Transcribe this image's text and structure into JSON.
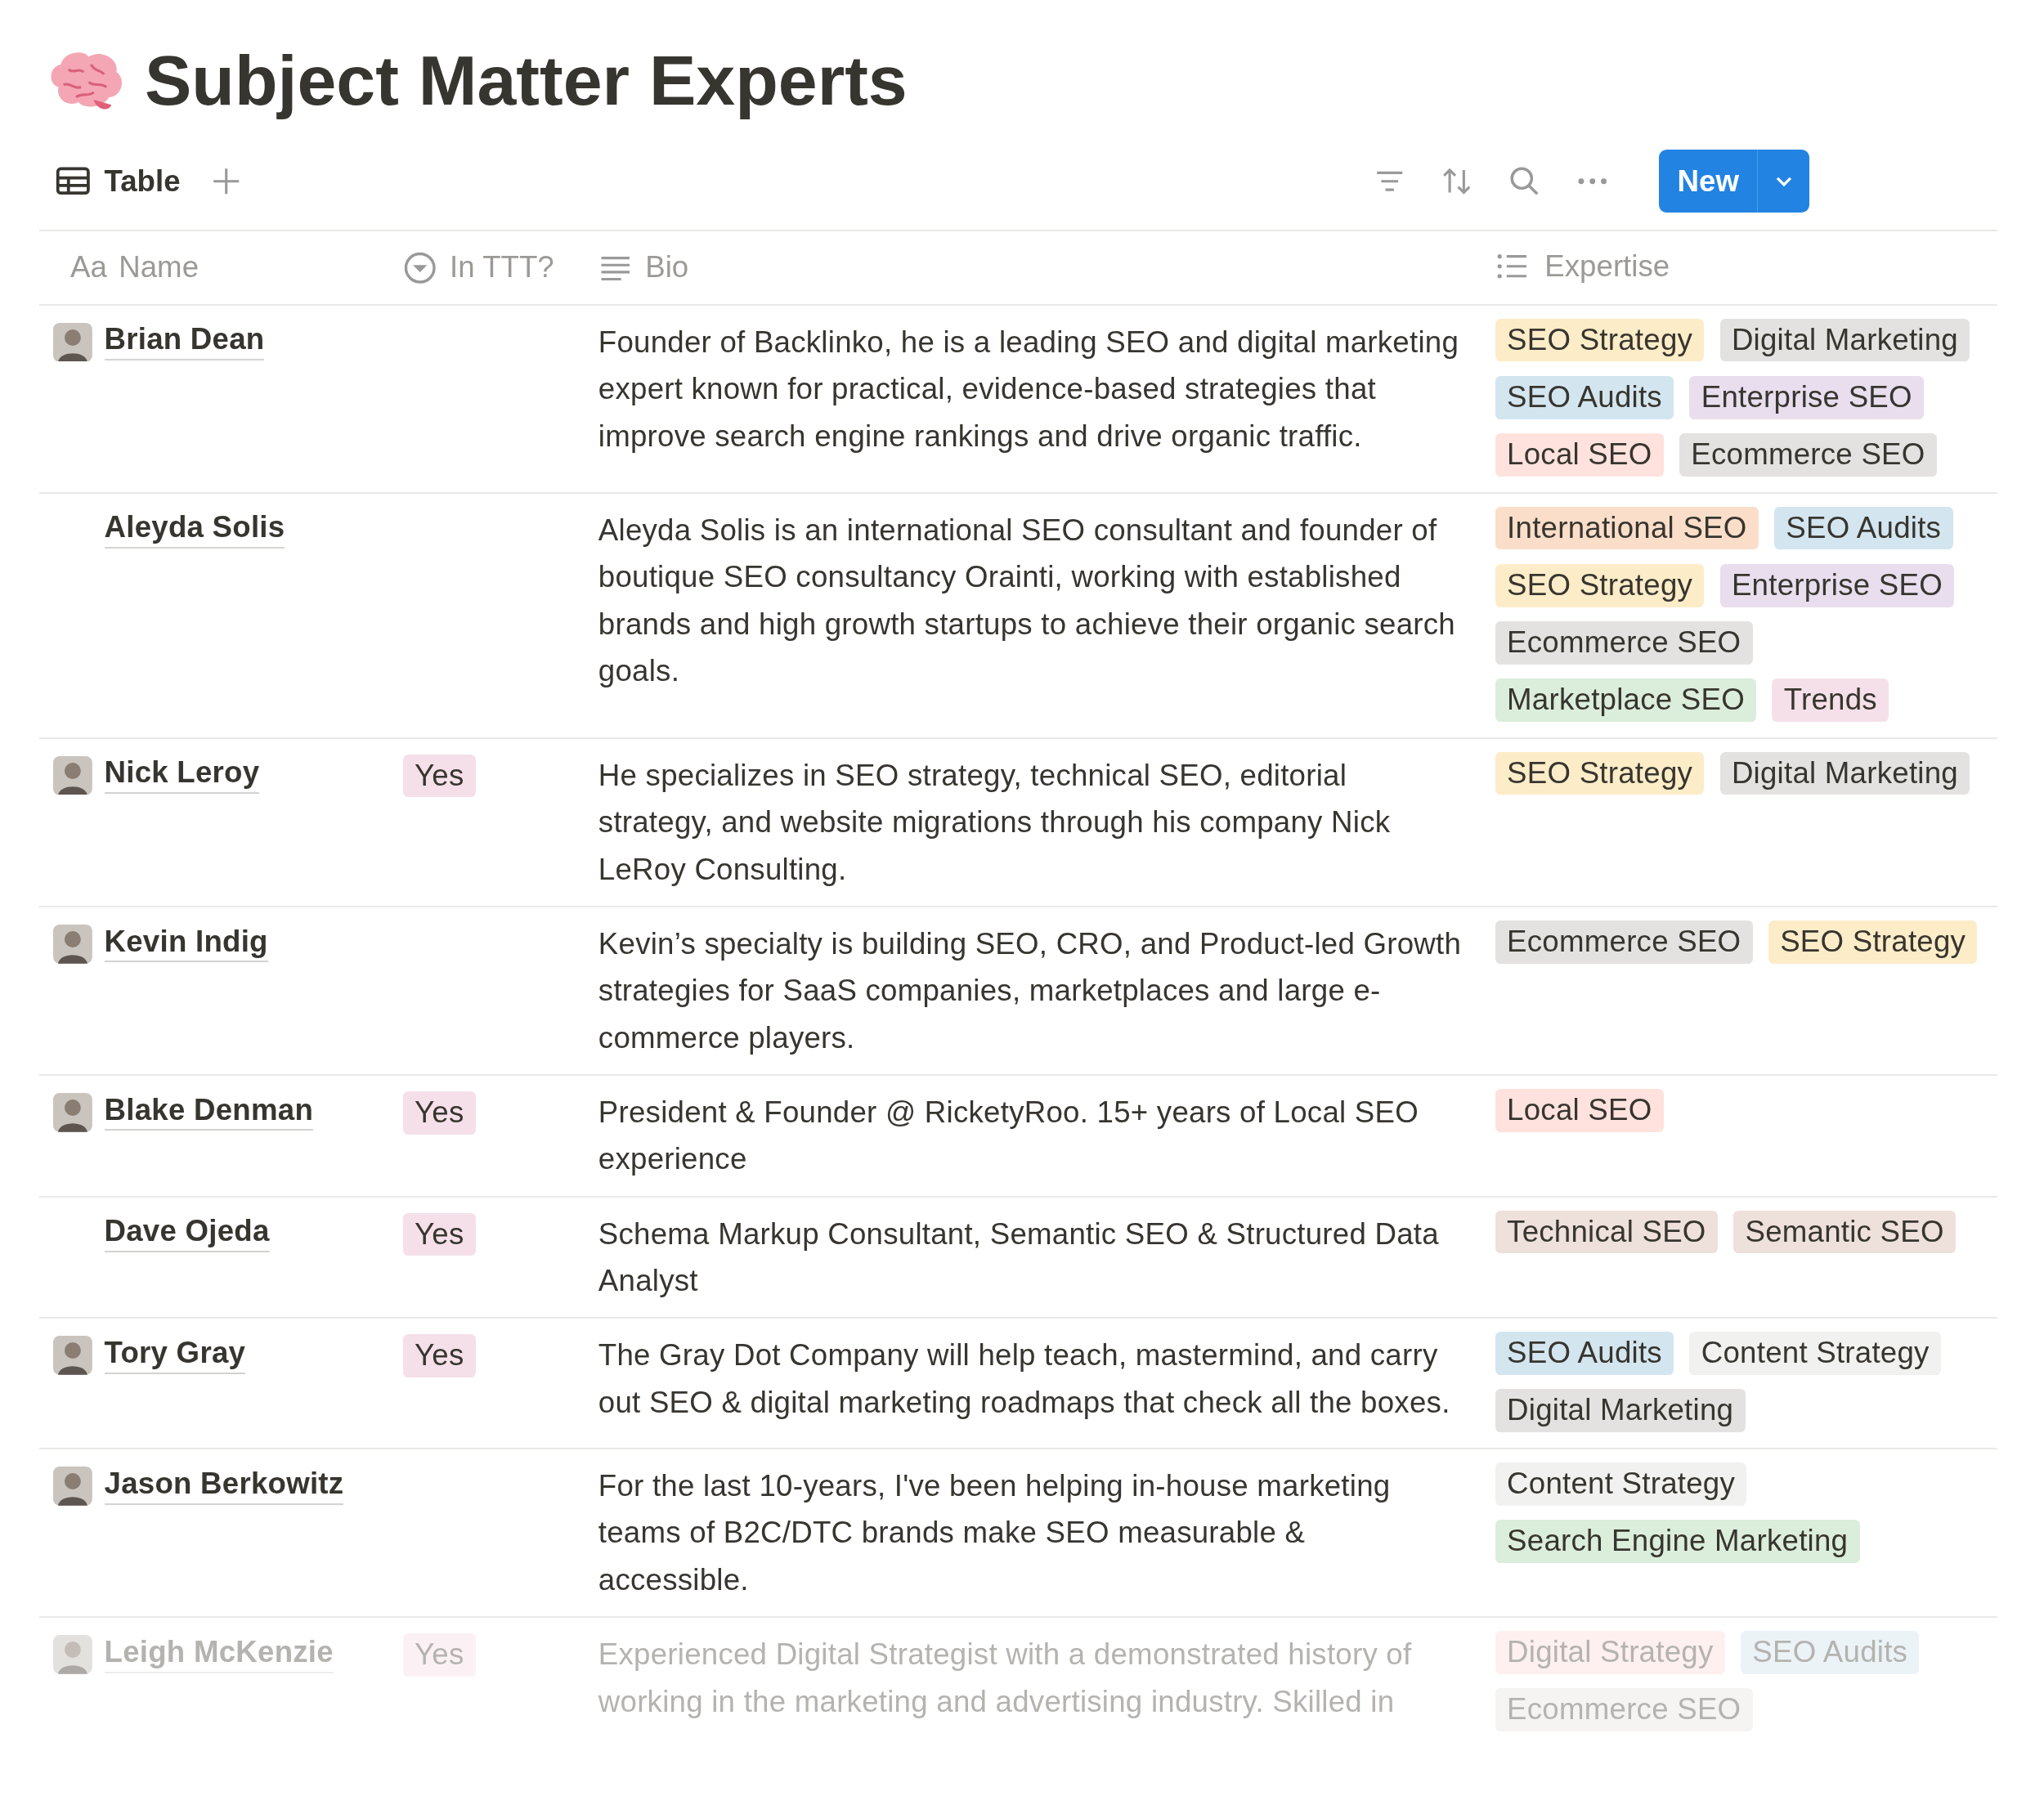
{
  "page": {
    "title": "Subject Matter Experts"
  },
  "view_tabs": [
    {
      "label": "Table",
      "selected": true
    }
  ],
  "toolbar": {
    "new_button": "New"
  },
  "table": {
    "columns": [
      {
        "label": "Name",
        "kind": "title",
        "icon_text": "Aa"
      },
      {
        "label": "In TTT?",
        "kind": "select"
      },
      {
        "label": "Bio",
        "kind": "text"
      },
      {
        "label": "Expertise",
        "kind": "multi"
      }
    ],
    "rows": [
      {
        "name": "Brian Dean",
        "avatar": true,
        "faded": false,
        "in_ttt": null,
        "bio": "Founder of Backlinko, he is a leading SEO and digital marketing expert known for practical, evidence-based strategies that improve search engine rankings and drive organic traffic.",
        "expertise": [
          {
            "label": "SEO Strategy",
            "color": "#fdecc8"
          },
          {
            "label": "Digital Marketing",
            "color": "#e3e2e0"
          },
          {
            "label": "SEO Audits",
            "color": "#d3e5ef"
          },
          {
            "label": "Enterprise SEO",
            "color": "#e8deee"
          },
          {
            "label": "Local SEO",
            "color": "#ffe2dd"
          },
          {
            "label": "Ecommerce SEO",
            "color": "#e3e2e0"
          }
        ]
      },
      {
        "name": "Aleyda Solis",
        "avatar": false,
        "faded": false,
        "in_ttt": null,
        "bio": "Aleyda Solis is an international SEO consultant and founder of boutique SEO consultancy Orainti, working with established brands and high growth startups to achieve their organic search goals.",
        "expertise": [
          {
            "label": "International SEO",
            "color": "#fadec9"
          },
          {
            "label": "SEO Audits",
            "color": "#d3e5ef"
          },
          {
            "label": "SEO Strategy",
            "color": "#fdecc8"
          },
          {
            "label": "Enterprise SEO",
            "color": "#e8deee"
          },
          {
            "label": "Ecommerce SEO",
            "color": "#e3e2e0"
          },
          {
            "label": "Marketplace SEO",
            "color": "#dbeddb"
          },
          {
            "label": "Trends",
            "color": "#f5e0e9"
          }
        ]
      },
      {
        "name": "Nick Leroy",
        "avatar": true,
        "faded": false,
        "in_ttt": "Yes",
        "bio": "He specializes in SEO strategy, technical SEO, editorial strategy, and website migrations through his company Nick LeRoy Consulting.",
        "expertise": [
          {
            "label": "SEO Strategy",
            "color": "#fdecc8"
          },
          {
            "label": "Digital Marketing",
            "color": "#e3e2e0"
          }
        ]
      },
      {
        "name": "Kevin Indig",
        "avatar": true,
        "faded": false,
        "in_ttt": null,
        "bio": "Kevin’s specialty is building SEO, CRO, and Product-led Growth strategies for SaaS companies, marketplaces and large e-commerce players.",
        "expertise": [
          {
            "label": "Ecommerce SEO",
            "color": "#e3e2e0"
          },
          {
            "label": "SEO Strategy",
            "color": "#fdecc8"
          }
        ]
      },
      {
        "name": "Blake Denman",
        "avatar": true,
        "faded": false,
        "in_ttt": "Yes",
        "bio": "President & Founder @ RicketyRoo. 15+ years of Local SEO experience",
        "expertise": [
          {
            "label": "Local SEO",
            "color": "#ffe2dd"
          }
        ]
      },
      {
        "name": "Dave Ojeda",
        "avatar": false,
        "faded": false,
        "in_ttt": "Yes",
        "bio": "Schema Markup Consultant, Semantic SEO & Structured Data Analyst",
        "expertise": [
          {
            "label": "Technical SEO",
            "color": "#eee0da"
          },
          {
            "label": "Semantic SEO",
            "color": "#eee0da"
          }
        ]
      },
      {
        "name": "Tory Gray",
        "avatar": true,
        "faded": false,
        "in_ttt": "Yes",
        "bio": "The Gray Dot Company will help teach, mastermind, and carry out SEO & digital marketing roadmaps that check all the boxes.",
        "expertise": [
          {
            "label": "SEO Audits",
            "color": "#d3e5ef"
          },
          {
            "label": "Content Strategy",
            "color": "#f1f1ef"
          },
          {
            "label": "Digital Marketing",
            "color": "#e3e2e0"
          }
        ]
      },
      {
        "name": "Jason Berkowitz",
        "avatar": true,
        "faded": false,
        "in_ttt": null,
        "bio": "For the last 10-years, I've been helping in-house marketing teams of B2C/DTC brands make SEO measurable & accessible.",
        "expertise": [
          {
            "label": "Content Strategy",
            "color": "#f1f1ef"
          },
          {
            "label": "Search Engine Marketing",
            "color": "#dbeddb"
          }
        ]
      },
      {
        "name": "Leigh McKenzie",
        "avatar": true,
        "faded": true,
        "in_ttt": "Yes",
        "bio": "Experienced Digital Strategist with a demonstrated history of working in the marketing and advertising industry. Skilled in",
        "expertise": [
          {
            "label": "Digital Strategy",
            "color": "#fdf0ef"
          },
          {
            "label": "SEO Audits",
            "color": "#ebf3f7"
          },
          {
            "label": "Ecommerce SEO",
            "color": "#f5f4f3"
          }
        ]
      }
    ]
  }
}
